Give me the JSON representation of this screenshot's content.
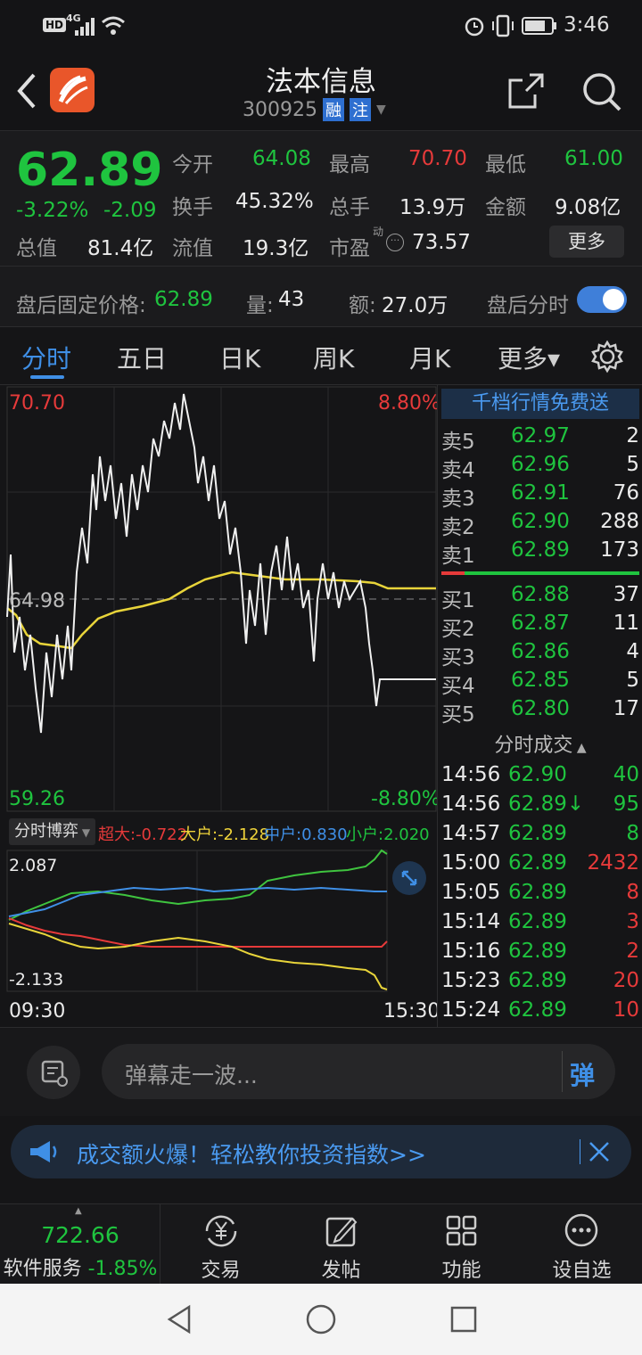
{
  "statusbar": {
    "network": "4G",
    "hd": "HD",
    "time": "3:46"
  },
  "header": {
    "title": "法本信息",
    "code": "300925",
    "badge_rong": "融",
    "badge_zhu": "注"
  },
  "quote": {
    "price": "62.89",
    "change_pct": "-3.22%",
    "change": "-2.09",
    "open_label": "今开",
    "open": "64.08",
    "high_label": "最高",
    "high": "70.70",
    "low_label": "最低",
    "low": "61.00",
    "turnover_label": "换手",
    "turnover": "45.32%",
    "volume_label": "总手",
    "volume": "13.9万",
    "amount_label": "金额",
    "amount": "9.08亿",
    "mktcap_label": "总值",
    "mktcap": "81.4亿",
    "float_label": "流值",
    "float": "19.3亿",
    "pe_label": "市盈",
    "pe_sup": "动",
    "pe": "73.57",
    "more_button": "更多"
  },
  "afterhours": {
    "label": "盘后固定价格:",
    "price": "62.89",
    "vol_label": "量:",
    "vol": "43",
    "amt_label": "额:",
    "amt": "27.0万",
    "toggle_label": "盘后分时"
  },
  "tabs": {
    "t1": "分时",
    "t2": "五日",
    "t3": "日K",
    "t4": "周K",
    "t5": "月K",
    "t6": "更多▾"
  },
  "chart": {
    "top_price": "70.70",
    "top_pct": "8.80%",
    "mid_price": "64.98",
    "bottom_price": "59.26",
    "bottom_pct": "-8.80%",
    "sub_title": "分时博弈",
    "legend_super": "超大:-0.722",
    "legend_big": "大户:-2.128",
    "legend_mid": "中户:0.830",
    "legend_small": "小户:2.020",
    "sub_max": "2.087",
    "sub_min": "-2.133",
    "time_start": "09:30",
    "time_end": "15:30"
  },
  "colors": {
    "up": "#e63a3a",
    "down": "#1fc43f",
    "price_line": "#f0f0f0",
    "avg_line": "#e8d43a",
    "accent": "#3f8fe6"
  },
  "orderbook": {
    "promo": "千档行情免费送",
    "asks": [
      {
        "label": "卖5",
        "price": "62.97",
        "vol": "2"
      },
      {
        "label": "卖4",
        "price": "62.96",
        "vol": "5"
      },
      {
        "label": "卖3",
        "price": "62.91",
        "vol": "76"
      },
      {
        "label": "卖2",
        "price": "62.90",
        "vol": "288"
      },
      {
        "label": "卖1",
        "price": "62.89",
        "vol": "173"
      }
    ],
    "bids": [
      {
        "label": "买1",
        "price": "62.88",
        "vol": "37"
      },
      {
        "label": "买2",
        "price": "62.87",
        "vol": "11"
      },
      {
        "label": "买3",
        "price": "62.86",
        "vol": "4"
      },
      {
        "label": "买4",
        "price": "62.85",
        "vol": "5"
      },
      {
        "label": "买5",
        "price": "62.80",
        "vol": "17"
      }
    ],
    "trades_title": "分时成交",
    "trades": [
      {
        "time": "14:56",
        "price": "62.90",
        "vol": "40"
      },
      {
        "time": "14:56",
        "price": "62.89↓",
        "vol": "95"
      },
      {
        "time": "14:57",
        "price": "62.89",
        "vol": "8"
      },
      {
        "time": "15:00",
        "price": "62.89",
        "vol": "2432"
      },
      {
        "time": "15:05",
        "price": "62.89",
        "vol": "8"
      },
      {
        "time": "15:14",
        "price": "62.89",
        "vol": "3"
      },
      {
        "time": "15:16",
        "price": "62.89",
        "vol": "2"
      },
      {
        "time": "15:23",
        "price": "62.89",
        "vol": "20"
      },
      {
        "time": "15:24",
        "price": "62.89",
        "vol": "10"
      }
    ]
  },
  "comment": {
    "placeholder": "弹幕走一波...",
    "send": "弹"
  },
  "banner": {
    "text": "成交额火爆！轻松教你投资指数>>"
  },
  "bottomnav": {
    "index_value": "722.66",
    "index_name": "软件服务",
    "index_change": "-1.85%",
    "trade": "交易",
    "post": "发帖",
    "function": "功能",
    "watchlist": "设自选"
  }
}
